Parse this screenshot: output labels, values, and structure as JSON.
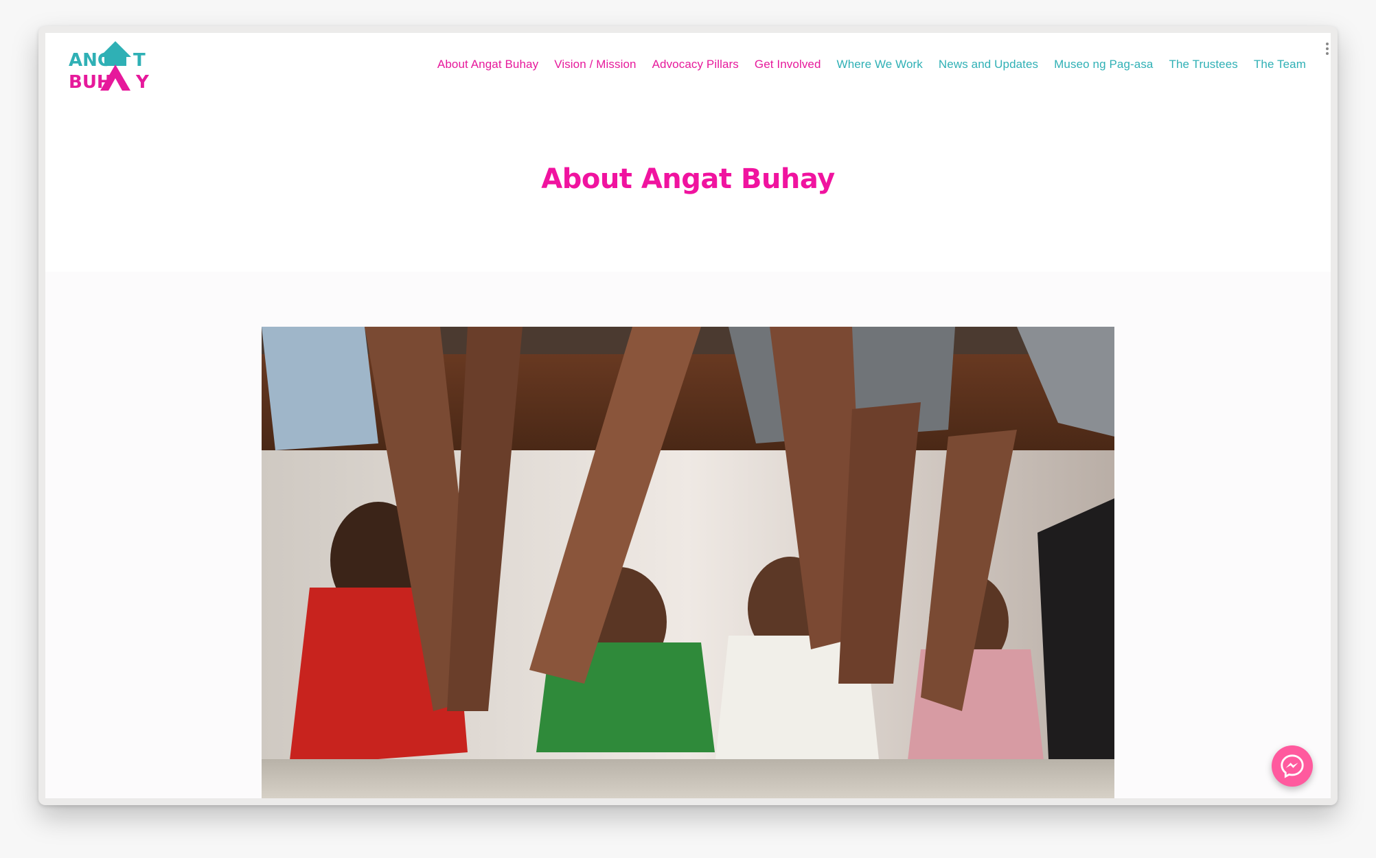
{
  "brand": {
    "logo_line1_left": "ANG",
    "logo_line1_right": "T",
    "logo_line2_left": "BUH",
    "logo_line2_right": "Y",
    "colors": {
      "pink": "#e6199b",
      "teal": "#2fb0b5",
      "title": "#f0139f",
      "messenger": "#ff5a9e"
    }
  },
  "nav": {
    "items": [
      {
        "label": "About Angat Buhay",
        "color": "pink"
      },
      {
        "label": "Vision / Mission",
        "color": "pink"
      },
      {
        "label": "Advocacy Pillars",
        "color": "pink"
      },
      {
        "label": "Get Involved",
        "color": "pink"
      },
      {
        "label": "Where We Work",
        "color": "teal"
      },
      {
        "label": "News and Updates",
        "color": "teal"
      },
      {
        "label": "Museo ng Pag-asa",
        "color": "teal"
      },
      {
        "label": "The Trustees",
        "color": "teal"
      },
      {
        "label": "The Team",
        "color": "teal"
      }
    ]
  },
  "hero": {
    "title": "About Angat Buhay"
  },
  "photo": {
    "icon": "photo-children-under-bench"
  },
  "chat": {
    "icon": "messenger-icon"
  }
}
